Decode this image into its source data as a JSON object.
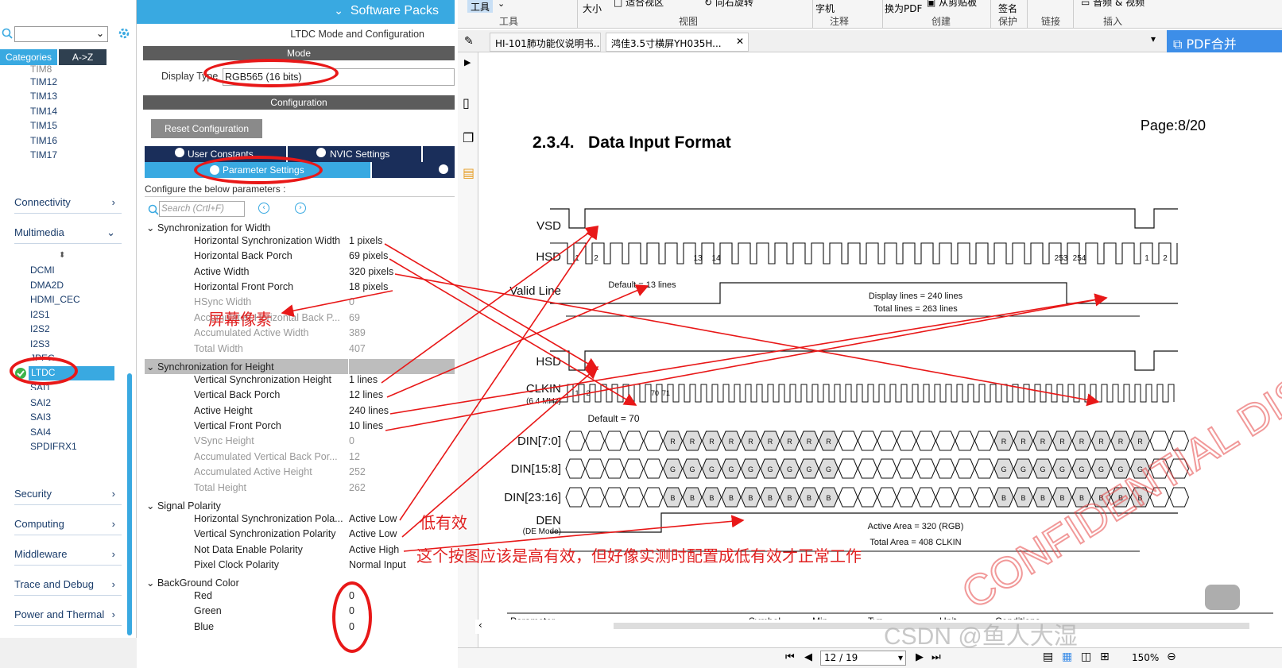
{
  "header": {
    "title": "Software Packs"
  },
  "sidebar": {
    "tabs": [
      "Categories",
      "A->Z"
    ],
    "timers": [
      "TIM8",
      "TIM12",
      "TIM13",
      "TIM14",
      "TIM15",
      "TIM16",
      "TIM17"
    ],
    "categories": {
      "connectivity": "Connectivity",
      "multimedia": "Multimedia",
      "security": "Security",
      "computing": "Computing",
      "middleware": "Middleware",
      "trace": "Trace and Debug",
      "power": "Power and Thermal"
    },
    "multimedia_items": [
      "DCMI",
      "DMA2D",
      "HDMI_CEC",
      "I2S1",
      "I2S2",
      "I2S3",
      "JPEG",
      "LTDC",
      "SAI1",
      "SAI2",
      "SAI3",
      "SAI4",
      "SPDIFRX1"
    ]
  },
  "mode_panel": {
    "title": "LTDC Mode and Configuration",
    "mode_label": "Mode",
    "display_type_label": "Display Type",
    "display_type_value": "RGB565 (16 bits)",
    "config_label": "Configuration",
    "reset_button": "Reset Configuration",
    "tabs": [
      "User Constants",
      "NVIC Settings",
      "Parameter Settings"
    ],
    "configure_hint": "Configure the below parameters :",
    "search_placeholder": "Search (Crtl+F)"
  },
  "params": {
    "width_group": "Synchronization for Width",
    "height_group": "Synchronization for Height",
    "polarity_group": "Signal Polarity",
    "bg_group": "BackGround Color",
    "rows": [
      {
        "label": "Horizontal Synchronization Width",
        "value": "1 pixels"
      },
      {
        "label": "Horizontal Back Porch",
        "value": "69 pixels"
      },
      {
        "label": "Active Width",
        "value": "320 pixels"
      },
      {
        "label": "Horizontal Front Porch",
        "value": "18 pixels"
      },
      {
        "label": "HSync Width",
        "value": "0"
      },
      {
        "label": "Accumulated Horizontal Back P...",
        "value": "69"
      },
      {
        "label": "Accumulated Active Width",
        "value": "389"
      },
      {
        "label": "Total Width",
        "value": "407"
      },
      {
        "label": "Vertical Synchronization Height",
        "value": "1 lines"
      },
      {
        "label": "Vertical Back Porch",
        "value": "12 lines"
      },
      {
        "label": "Active Height",
        "value": "240 lines"
      },
      {
        "label": "Vertical Front Porch",
        "value": "10 lines"
      },
      {
        "label": "VSync Height",
        "value": "0"
      },
      {
        "label": "Accumulated Vertical Back Por...",
        "value": "12"
      },
      {
        "label": "Accumulated Active Height",
        "value": "252"
      },
      {
        "label": "Total Height",
        "value": "262"
      },
      {
        "label": "Horizontal Synchronization Pola...",
        "value": "Active Low"
      },
      {
        "label": "Vertical Synchronization Polarity",
        "value": "Active Low"
      },
      {
        "label": "Not Data Enable Polarity",
        "value": "Active High"
      },
      {
        "label": "Pixel Clock Polarity",
        "value": "Normal Input"
      },
      {
        "label": "Red",
        "value": "0"
      },
      {
        "label": "Green",
        "value": "0"
      },
      {
        "label": "Blue",
        "value": "0"
      }
    ]
  },
  "annotations": {
    "pixels": "屏幕像素",
    "active_low": "低有效",
    "note": "这个按图应该是高有效，但好像实测时配置成低有效才正常工作"
  },
  "pdf": {
    "toolbar": {
      "tools": "工具",
      "size": "大小",
      "fit": "适合视区",
      "rotate": "向右旋转",
      "view": "视图",
      "text": "字机",
      "annot": "注释",
      "topdf": "换为PDF",
      "clip": "从剪贴板",
      "create": "创建",
      "sign": "签名",
      "protect": "保护",
      "link": "链接",
      "av": "音频 & 视频",
      "insert": "插入",
      "merge": "PDF合并"
    },
    "tabs": [
      "HI-101肺功能仪说明书...",
      "鸿佳3.5寸横屏YH035H..."
    ],
    "page_label": "Page:8/20",
    "heading": "2.3.4.   Data Input Format",
    "signals": {
      "vsd": "VSD",
      "hsd": "HSD",
      "valid": "Valid Line",
      "hsd2": "HSD",
      "clkin": "CLKIN",
      "clk_sub": "(6.4 MHz)",
      "din0": "DIN[7:0]",
      "din1": "DIN[15:8]",
      "din2": "DIN[23:16]",
      "den": "DEN",
      "den_sub": "(DE Mode)"
    },
    "labels": {
      "default13": "Default = 13 lines",
      "display": "Display lines = 240 lines",
      "total": "Total lines = 263 lines",
      "default70": "Default = 70",
      "area": "Active Area = 320 (RGB)",
      "totalarea": "Total Area = 408 CLKIN"
    },
    "hsd_nums": [
      "1",
      "2",
      "13",
      "14",
      "253",
      "254",
      "1",
      "2"
    ],
    "clk_nums": [
      "1",
      "2",
      "70",
      "71"
    ],
    "watermark": "CONFIDENTIAL DISCLOSURE",
    "page_nav": "12 / 19",
    "zoom": "150%",
    "credit": "CSDN @鱼人大湿",
    "table_head": [
      "Parameter",
      "Symbol",
      "Min",
      "Typ",
      "Unit",
      "Conditions"
    ]
  }
}
